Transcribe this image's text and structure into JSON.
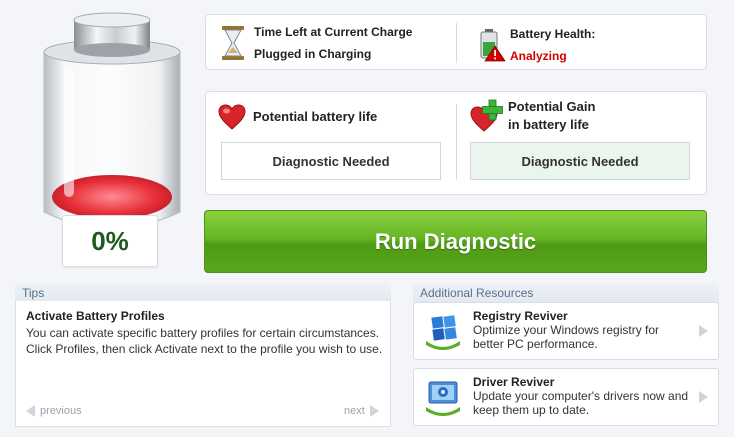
{
  "battery": {
    "charge_percent": "0%"
  },
  "info": {
    "time_left_label": "Time Left at Current Charge",
    "status_label": "Plugged in Charging",
    "health_label": "Battery Health:",
    "health_value": "Analyzing"
  },
  "potential": {
    "life_title": "Potential battery life",
    "life_value": "Diagnostic Needed",
    "gain_title_line1": "Potential Gain",
    "gain_title_line2": "in battery life",
    "gain_value": "Diagnostic Needed"
  },
  "actions": {
    "run_label": "Run Diagnostic"
  },
  "tips": {
    "header": "Tips",
    "title": "Activate Battery Profiles",
    "body": "You can activate specific battery profiles for certain circumstances. Click Profiles, then click Activate next to the profile you wish to use.",
    "previous_label": "previous",
    "next_label": "next"
  },
  "resources": {
    "header": "Additional Resources",
    "items": [
      {
        "title": "Registry Reviver",
        "desc": "Optimize your Windows registry for better PC performance.",
        "icon": "registry-reviver-icon"
      },
      {
        "title": "Driver Reviver",
        "desc": "Update your computer's drivers now and keep them up to date.",
        "icon": "driver-reviver-icon"
      }
    ]
  },
  "colors": {
    "accent_green": "#5aa61b",
    "warning_red": "#d40000",
    "heart_red": "#d8232a",
    "charge_red": "#e8303a"
  }
}
